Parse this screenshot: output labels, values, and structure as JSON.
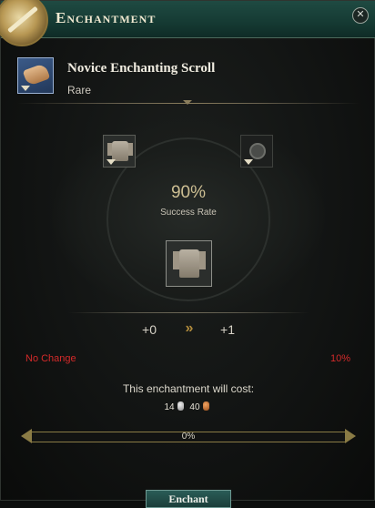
{
  "header": {
    "title": "Enchantment",
    "close_icon": "close-icon",
    "emblem_icon": "enchant-emblem-icon"
  },
  "scroll": {
    "name": "Novice Enchanting Scroll",
    "rarity": "Rare",
    "icon": "scroll-icon"
  },
  "enchant": {
    "success_rate": "90%",
    "success_label": "Success Rate",
    "level_from": "+0",
    "level_arrow": "»",
    "level_to": "+1",
    "item_icon": "armor-icon",
    "catalyst_icon": "catalyst-icon"
  },
  "failure": {
    "label": "No Change",
    "chance": "10%"
  },
  "cost": {
    "label": "This enchantment will cost:",
    "silver": "14",
    "copper": "40"
  },
  "progress": {
    "text": "0%",
    "value": 0
  },
  "button": {
    "label": "Enchant"
  },
  "colors": {
    "header": "#1f4a42",
    "accent": "#cdbf93",
    "warning": "#d42a2a",
    "progress_border": "#8a7b45"
  }
}
